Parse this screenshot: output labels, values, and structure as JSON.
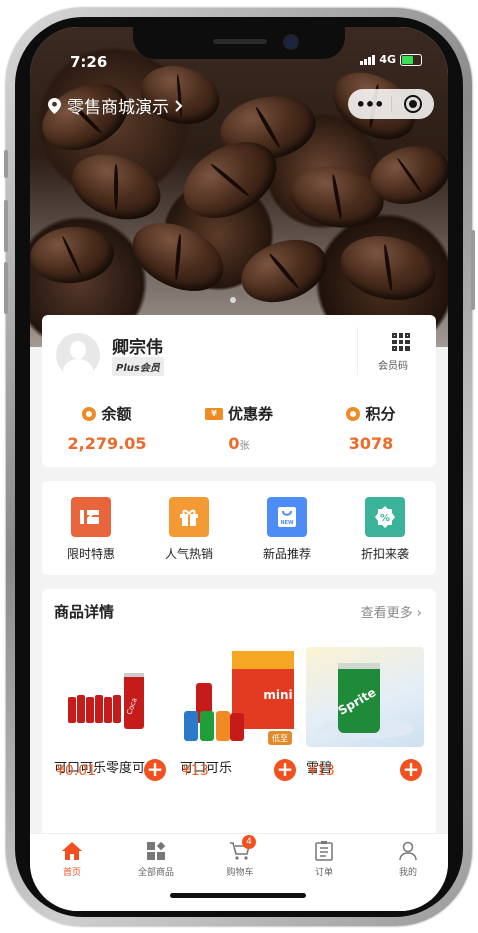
{
  "status_bar": {
    "time": "7:26",
    "network": "4G"
  },
  "header": {
    "location": "零售商城演示",
    "capsule_more": "•••"
  },
  "member": {
    "name": "卿宗伟",
    "level": "Plus会员",
    "qr_label": "会员码",
    "stats": [
      {
        "label": "余额",
        "value": "2,279.05",
        "unit": ""
      },
      {
        "label": "优惠券",
        "value": "0",
        "unit": "张"
      },
      {
        "label": "积分",
        "value": "3078",
        "unit": ""
      }
    ]
  },
  "quick_entries": [
    {
      "label": "限时特惠",
      "color": "#e8643a"
    },
    {
      "label": "人气热销",
      "color": "#f39a35"
    },
    {
      "label": "新品推荐",
      "color": "#4d8cf5"
    },
    {
      "label": "折扣来袭",
      "color": "#3bb39b"
    }
  ],
  "goods": {
    "title": "商品详情",
    "more": "查看更多",
    "items": [
      {
        "name": "可口可乐零度可乐",
        "price": "¥0.01"
      },
      {
        "name": "可口可乐",
        "price": "¥13"
      },
      {
        "name": "雪碧",
        "price": "¥13"
      }
    ]
  },
  "tabbar": {
    "items": [
      {
        "label": "首页",
        "icon": "home-icon",
        "active": true
      },
      {
        "label": "全部商品",
        "icon": "grid-icon",
        "active": false
      },
      {
        "label": "购物车",
        "icon": "cart-icon",
        "active": false,
        "badge": "4"
      },
      {
        "label": "订单",
        "icon": "order-icon",
        "active": false
      },
      {
        "label": "我的",
        "icon": "user-icon",
        "active": false
      }
    ]
  },
  "colors": {
    "accent": "#f2501e",
    "price": "#ee6a2a"
  }
}
